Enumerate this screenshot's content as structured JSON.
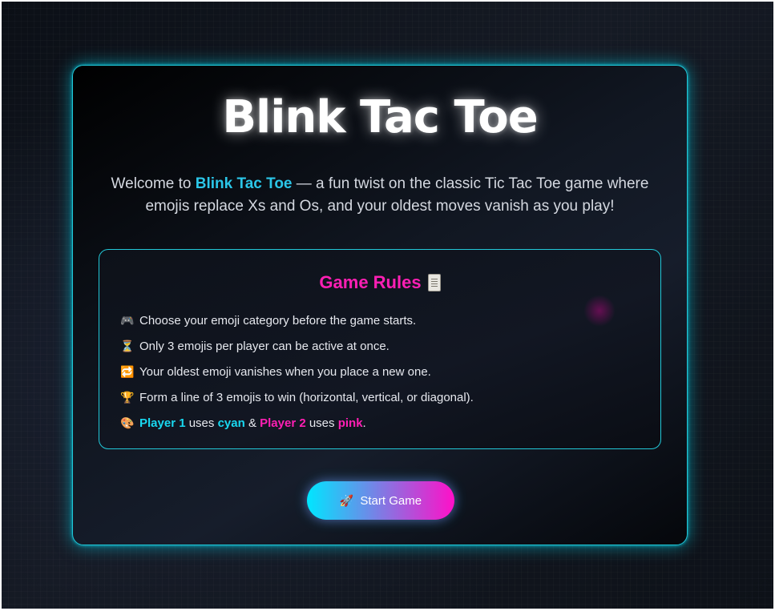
{
  "title": "Blink Tac Toe",
  "intro": {
    "prefix": "Welcome to ",
    "highlight": "Blink Tac Toe",
    "suffix": " — a fun twist on the classic Tic Tac Toe game where emojis replace Xs and Os, and your oldest moves vanish as you play!"
  },
  "rules": {
    "title": "Game Rules",
    "title_icon": "scroll-icon",
    "items": [
      {
        "icon": "🎮",
        "icon_name": "gamepad-icon",
        "text": "Choose your emoji category before the game starts."
      },
      {
        "icon": "⏳",
        "icon_name": "hourglass-icon",
        "text": "Only 3 emojis per player can be active at once."
      },
      {
        "icon": "🔁",
        "icon_name": "repeat-icon",
        "text": "Your oldest emoji vanishes when you place a new one."
      },
      {
        "icon": "🏆",
        "icon_name": "trophy-icon",
        "text": "Form a line of 3 emojis to win (horizontal, vertical, or diagonal)."
      }
    ],
    "player_rule": {
      "icon": "🎨",
      "icon_name": "palette-icon",
      "player1": "Player 1",
      "uses1": " uses ",
      "color1": "cyan",
      "amp": " & ",
      "player2": "Player 2",
      "uses2": " uses ",
      "color2": "pink",
      "end": "."
    }
  },
  "start_button": {
    "icon": "🚀",
    "icon_name": "rocket-icon",
    "label": "Start Game"
  },
  "colors": {
    "accent_cyan": "#22c8d8",
    "accent_pink": "#ff1fb4",
    "player1": "#19d8f0",
    "player2": "#ff1fb4"
  }
}
